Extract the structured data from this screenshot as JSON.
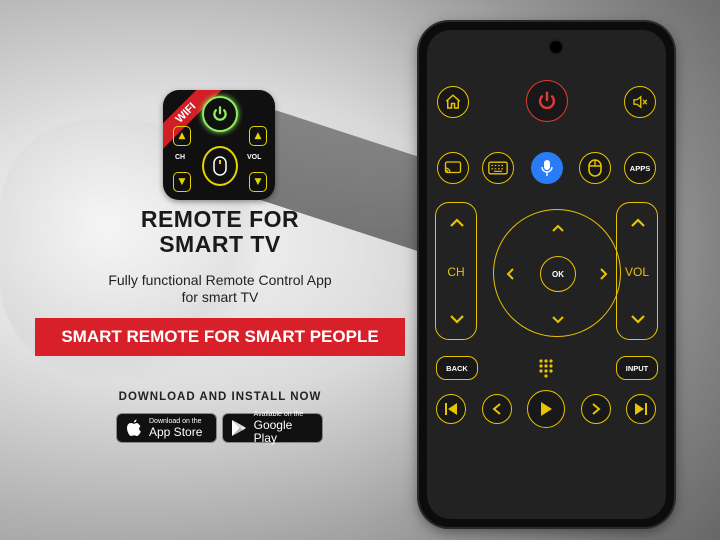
{
  "app_icon": {
    "ribbon": "WIFI",
    "ch_label": "CH",
    "vol_label": "VOL"
  },
  "title_line1": "REMOTE FOR",
  "title_line2": "SMART TV",
  "subtitle_line1": "Fully functional Remote Control App",
  "subtitle_line2": "for smart TV",
  "banner": "SMART REMOTE FOR SMART PEOPLE",
  "download_heading": "DOWNLOAD AND INSTALL NOW",
  "app_store": {
    "small": "Download on the",
    "big": "App Store"
  },
  "google_play": {
    "small": "Available on the",
    "big": "Google Play"
  },
  "remote": {
    "apps_label": "APPS",
    "ch_label": "CH",
    "vol_label": "VOL",
    "ok_label": "OK",
    "back_label": "BACK",
    "input_label": "INPUT"
  },
  "colors": {
    "accent_yellow": "#e8c400",
    "power_red": "#e53935",
    "mic_blue": "#2a7cf6",
    "banner_red": "#d8202a",
    "icon_green": "#8ef25d"
  }
}
